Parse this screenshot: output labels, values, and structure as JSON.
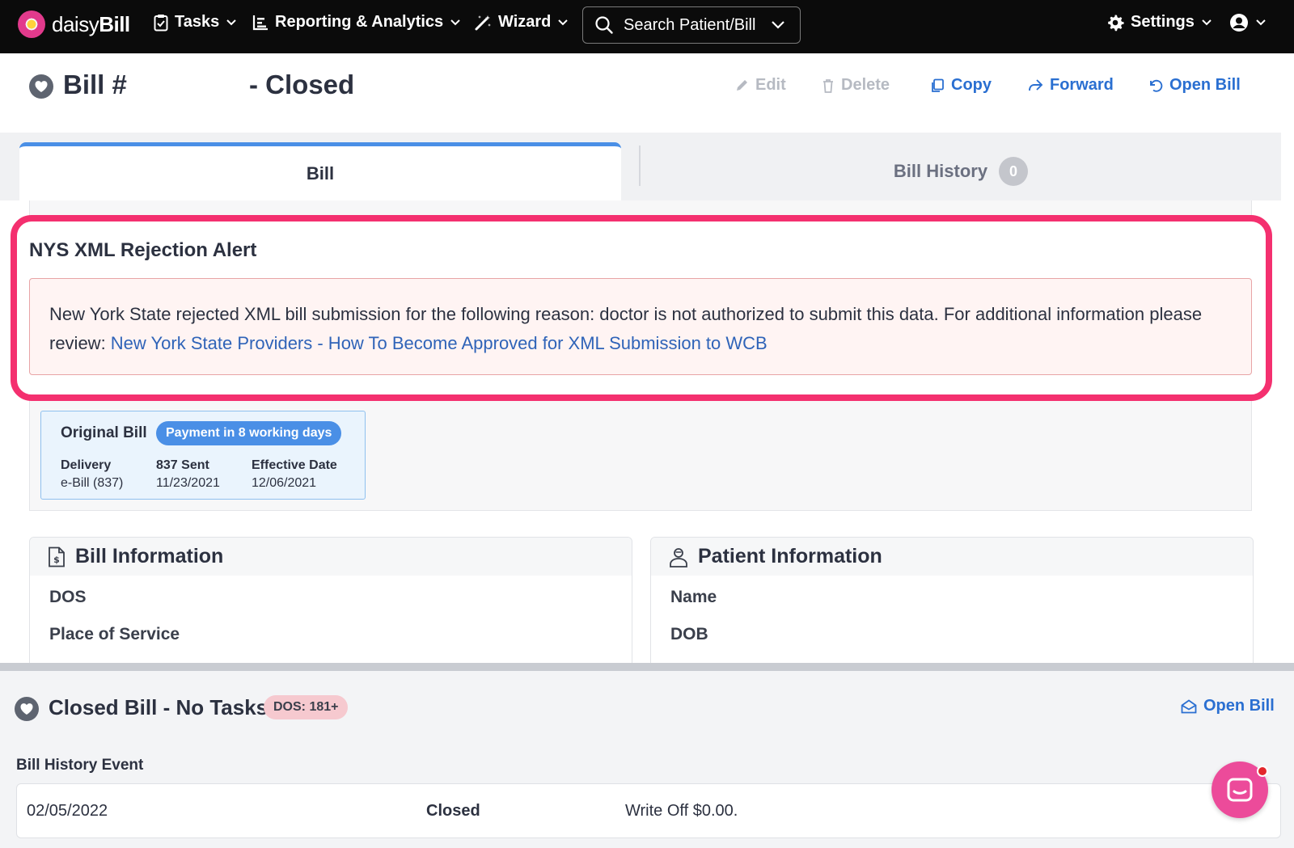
{
  "nav": {
    "logo_light": "daisy",
    "logo_bold": "Bill",
    "tasks": "Tasks",
    "reporting": "Reporting & Analytics",
    "wizard": "Wizard",
    "search_placeholder": "Search Patient/Bill",
    "settings": "Settings"
  },
  "header": {
    "title": "Bill #",
    "status": "- Closed",
    "actions": {
      "edit": "Edit",
      "delete": "Delete",
      "copy": "Copy",
      "forward": "Forward",
      "open_bill": "Open Bill"
    }
  },
  "tabs": {
    "bill": "Bill",
    "history": "Bill History",
    "history_count": "0"
  },
  "alert": {
    "title": "NYS XML Rejection Alert",
    "message": "New York State rejected XML bill submission for the following reason: doctor is not authorized to submit this data. For additional information please review: ",
    "link": "New York State Providers - How To Become Approved for XML Submission to WCB"
  },
  "original_bill": {
    "title": "Original Bill",
    "pill": "Payment in 8 working days",
    "delivery_label": "Delivery",
    "delivery_value": "e-Bill (837)",
    "sent_label": "837 Sent",
    "sent_value": "11/23/2021",
    "effective_label": "Effective Date",
    "effective_value": "12/06/2021"
  },
  "bill_info": {
    "title": "Bill Information",
    "row1": "DOS",
    "row2": "Place of Service"
  },
  "patient_info": {
    "title": "Patient Information",
    "row1": "Name",
    "row2": "DOB"
  },
  "bottom": {
    "title": "Closed Bill - No Tasks",
    "dos_pill": "DOS: 181+",
    "open_bill": "Open Bill",
    "history_label": "Bill History Event",
    "event_date": "02/05/2022",
    "event_status": "Closed",
    "event_desc": "Write Off $0.00."
  },
  "colors": {
    "accent": "#2a6fd1",
    "highlight": "#f4306f",
    "tab_indicator": "#4a8fe6",
    "chat": "#ec4b9a"
  }
}
